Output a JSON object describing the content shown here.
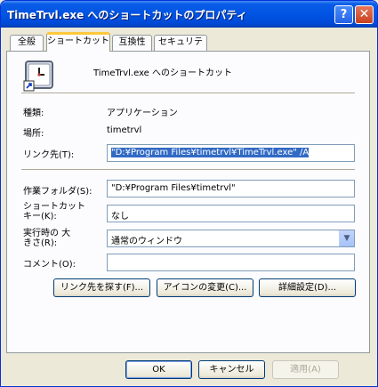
{
  "window": {
    "title": "TimeTrvl.exe へのショートカットのプロパティ",
    "help_label": "?",
    "close_label": "✕"
  },
  "tabs": [
    {
      "label": "全般"
    },
    {
      "label": "ショートカット"
    },
    {
      "label": "互換性"
    },
    {
      "label": "セキュリティ"
    }
  ],
  "header": {
    "icon": "clock-shortcut-icon",
    "name": "TimeTrvl.exe へのショートカット"
  },
  "info": {
    "type_label": "種類:",
    "type_value": "アプリケーション",
    "location_label": "場所:",
    "location_value": "timetrvl"
  },
  "fields": {
    "target_label": "リンク先(T):",
    "target_value": "\"D:¥Program Files¥timetrvl¥TimeTrvl.exe\" /A",
    "workdir_label": "作業フォルダ(S):",
    "workdir_value": "\"D:¥Program Files¥timetrvl\"",
    "hotkey_label": "ショートカット キー(K):",
    "hotkey_value": "なし",
    "run_label": "実行時の 大きさ(R):",
    "run_value": "通常のウィンドウ",
    "comment_label": "コメント(O):",
    "comment_value": ""
  },
  "actions": {
    "find_target": "リンク先を探す(F)...",
    "change_icon": "アイコンの変更(C)...",
    "advanced": "詳細設定(D)..."
  },
  "footer": {
    "ok": "OK",
    "cancel": "キャンセル",
    "apply": "適用(A)"
  },
  "colors": {
    "titlebar": "#0054e3",
    "selection": "#316ac5",
    "active_tab_accent": "#ffc83c"
  }
}
